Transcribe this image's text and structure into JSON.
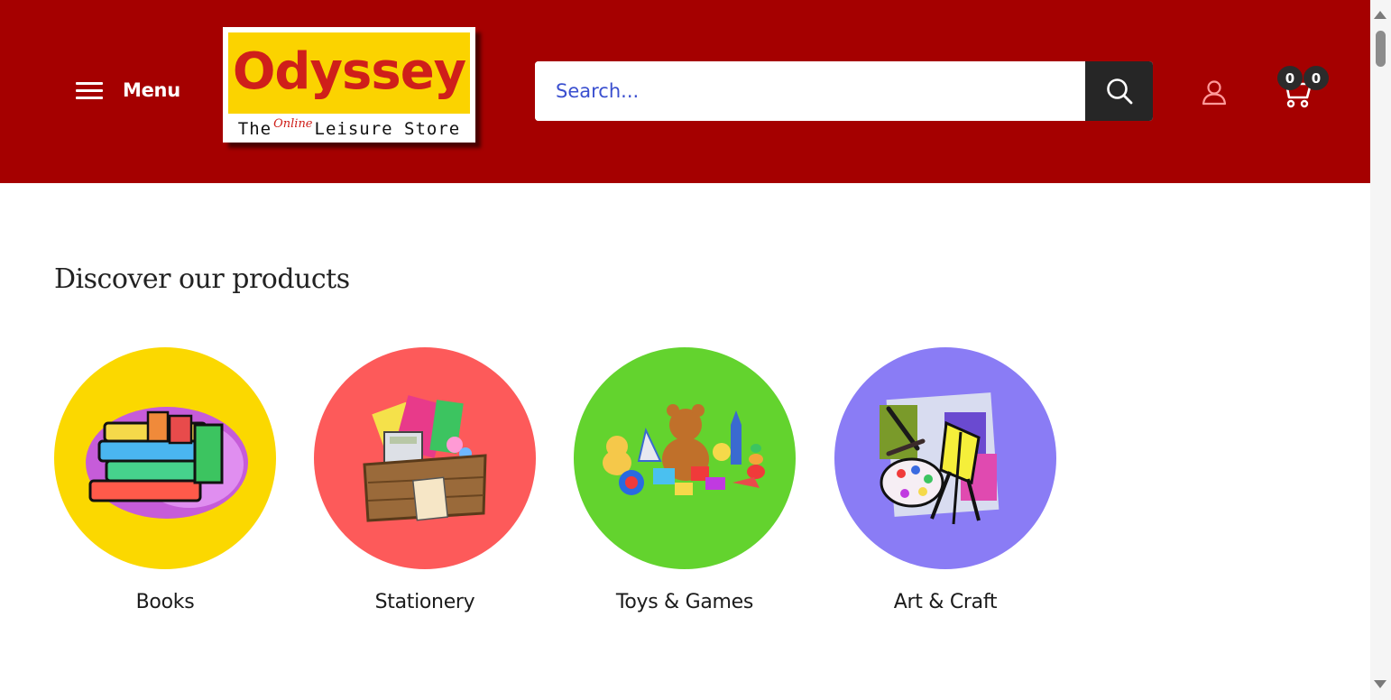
{
  "header": {
    "menu_label": "Menu",
    "logo": {
      "name": "Odyssey",
      "tagline_left": "The",
      "tagline_online": "Online",
      "tagline_right": "Leisure Store"
    },
    "search": {
      "placeholder": "Search..."
    },
    "cart": {
      "count_a": "0",
      "count_b": "0"
    }
  },
  "main": {
    "section_title": "Discover our products",
    "categories": [
      {
        "label": "Books",
        "color": "#fbd800",
        "icon": "books-icon"
      },
      {
        "label": "Stationery",
        "color": "#fd5a5a",
        "icon": "stationery-icon"
      },
      {
        "label": "Toys & Games",
        "color": "#63d32e",
        "icon": "toys-icon"
      },
      {
        "label": "Art & Craft",
        "color": "#8a7cf5",
        "icon": "art-palette-icon"
      }
    ]
  },
  "colors": {
    "header_bg": "#a50000",
    "search_button_bg": "#262626",
    "placeholder": "#3a4fcf"
  }
}
